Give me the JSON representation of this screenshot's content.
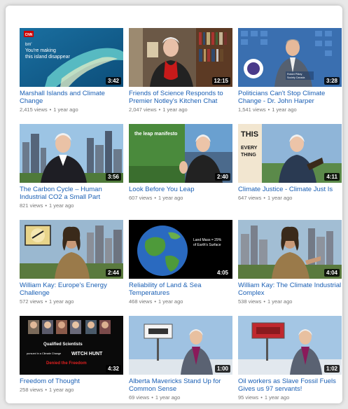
{
  "videos": [
    {
      "title": "Marshall Islands and Climate Change",
      "views": "2,415 views",
      "age": "1 year ago",
      "duration": "3:42",
      "overlay": {
        "badge": "CNN",
        "line1": "bm'",
        "line2": "You're making",
        "line3": "this island disappear"
      }
    },
    {
      "title": "Friends of Science Responds to Premier Notley's Kitchen Chat",
      "views": "2,047 views",
      "age": "1 year ago",
      "duration": "12:15"
    },
    {
      "title": "Politicians Can't Stop Climate Change - Dr. John Harper",
      "views": "1,541 views",
      "age": "1 year ago",
      "duration": "3:28",
      "overlay": {
        "caption1": "Robert Pilkey",
        "caption2": "Society Canada"
      }
    },
    {
      "title": "The Carbon Cycle – Human Industrial CO2 a Small Part",
      "views": "821 views",
      "age": "1 year ago",
      "duration": "3:56"
    },
    {
      "title": "Look Before You Leap",
      "views": "607 views",
      "age": "1 year ago",
      "duration": "2:40",
      "overlay": {
        "text": "the leap manifesto"
      }
    },
    {
      "title": "Climate Justice - Climate Just Is",
      "views": "647 views",
      "age": "1 year ago",
      "duration": "4:11",
      "overlay": {
        "line1": "THIS",
        "line2": "EVERY",
        "line3": "THING"
      }
    },
    {
      "title": "William Kay: Europe's Energy Challenge",
      "views": "572 views",
      "age": "1 year ago",
      "duration": "2:44"
    },
    {
      "title": "Reliability of Land & Sea Temperatures",
      "views": "468 views",
      "age": "1 year ago",
      "duration": "4:05",
      "overlay": {
        "line1": "Land Mass = 29%",
        "line2": "of Earth's Surface"
      }
    },
    {
      "title": "William Kay: The Climate Industrial Complex",
      "views": "538 views",
      "age": "1 year ago",
      "duration": "4:04"
    },
    {
      "title": "Freedom of Thought",
      "views": "258 views",
      "age": "1 year ago",
      "duration": "4:32",
      "overlay": {
        "line1": "Qualified Scientists",
        "line2": "pursued in a Climate Change",
        "line3": "WITCH HUNT",
        "line4": "Denied the Freedom"
      }
    },
    {
      "title": "Alberta Mavericks Stand Up for Common Sense",
      "views": "69 views",
      "age": "1 year ago",
      "duration": "1:00"
    },
    {
      "title": "Oil workers as Slave Fossil Fuels Gives us 97 servants!",
      "views": "95 views",
      "age": "1 year ago",
      "duration": "1:02"
    }
  ],
  "colors": {
    "title": "#1a5fb4",
    "meta": "#767676",
    "duration_bg": "#000000"
  }
}
